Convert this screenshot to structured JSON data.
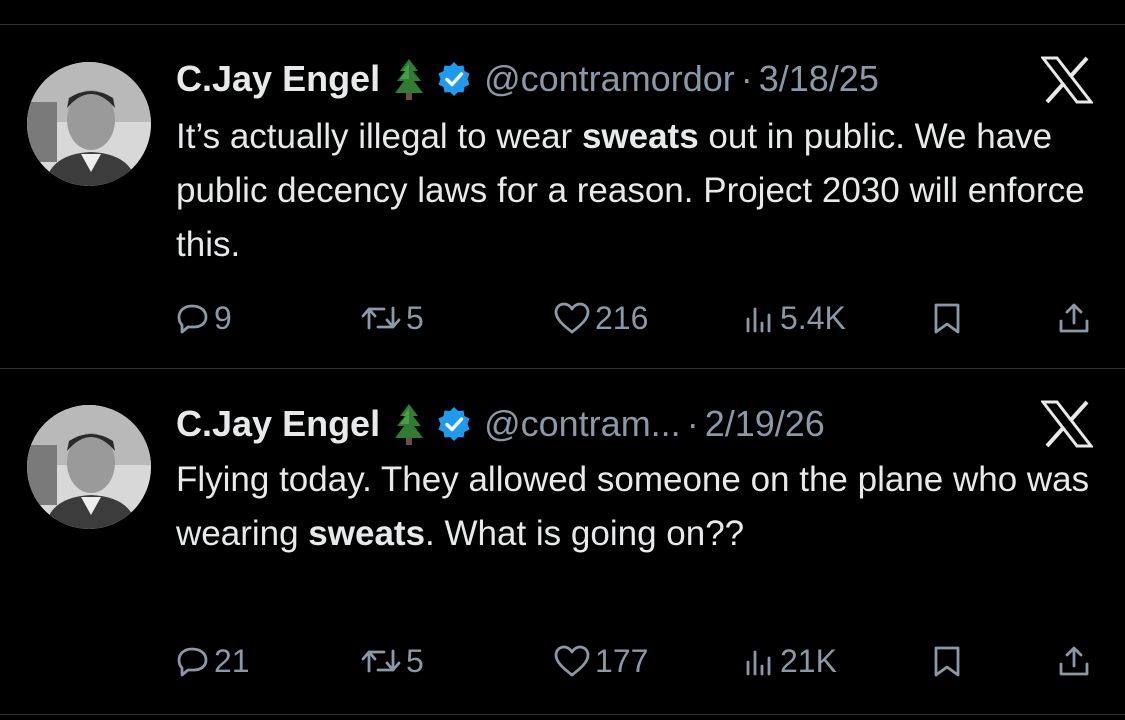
{
  "tweets": [
    {
      "author_name": "C.Jay Engel",
      "badge_emoji_icon": "evergreen-tree-icon",
      "verified_icon": "verified-badge-icon",
      "handle": "@contramordor",
      "separator": "·",
      "date": "3/18/25",
      "text_parts": [
        {
          "text": "It’s actually illegal to wear ",
          "bold": false
        },
        {
          "text": "sweats",
          "bold": true
        },
        {
          "text": " out in public. We have public decency laws for a reason. Project 2030 will enforce this.",
          "bold": false
        }
      ],
      "replies": "9",
      "reposts": "5",
      "likes": "216",
      "views": "5.4K"
    },
    {
      "author_name": "C.Jay Engel",
      "badge_emoji_icon": "evergreen-tree-icon",
      "verified_icon": "verified-badge-icon",
      "handle": "@contram...",
      "separator": "·",
      "date": "2/19/26",
      "text_parts": [
        {
          "text": "Flying today. They allowed someone on the plane who was wearing ",
          "bold": false
        },
        {
          "text": "sweats",
          "bold": true
        },
        {
          "text": ". What is going on??",
          "bold": false
        }
      ],
      "replies": "21",
      "reposts": "5",
      "likes": "177",
      "views": "21K"
    }
  ],
  "colors": {
    "background": "#000000",
    "text": "#e7e9ea",
    "muted": "#8b98a5",
    "verified_blue": "#1d9bf0",
    "divider": "#2f3336"
  }
}
